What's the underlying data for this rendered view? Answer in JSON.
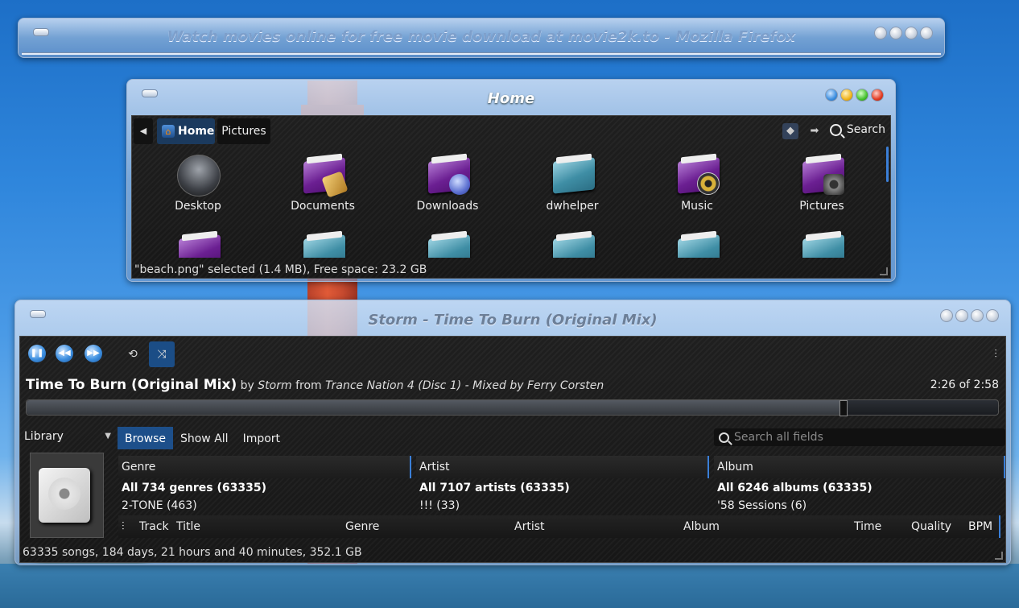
{
  "firefox": {
    "title": "Watch movies online for free movie download at movie2k.to - Mozilla Firefox"
  },
  "file_manager": {
    "title": "Home",
    "breadcrumbs": [
      {
        "label": "Home",
        "active": true
      },
      {
        "label": "Pictures",
        "active": false
      }
    ],
    "search_label": "Search",
    "items": [
      {
        "label": "Desktop",
        "icon": "desktop-icon",
        "color": "#444"
      },
      {
        "label": "Documents",
        "icon": "documents-folder-icon",
        "color": "#7a2aa3"
      },
      {
        "label": "Downloads",
        "icon": "downloads-folder-icon",
        "color": "#7a2aa3"
      },
      {
        "label": "dwhelper",
        "icon": "folder-icon",
        "color": "#3f8ea5"
      },
      {
        "label": "Music",
        "icon": "music-folder-icon",
        "color": "#7a2aa3"
      },
      {
        "label": "Pictures",
        "icon": "pictures-folder-icon",
        "color": "#7a2aa3"
      }
    ],
    "status": "\"beach.png\" selected (1.4 MB), Free space: 23.2 GB"
  },
  "music_player": {
    "title": "Storm - Time To Burn (Original Mix)",
    "now_playing": {
      "track": "Time To Burn (Original Mix)",
      "by_word": "by",
      "artist": "Storm",
      "from_word": "from",
      "album": "Trance Nation 4 (Disc 1) - Mixed by Ferry Corsten"
    },
    "time_position": "2:26 of 2:58",
    "progress": 0.84,
    "library_label": "Library",
    "tabs": [
      {
        "label": "Browse",
        "active": true
      },
      {
        "label": "Show All",
        "active": false
      },
      {
        "label": "Import",
        "active": false
      }
    ],
    "search_placeholder": "Search all fields",
    "browser_columns": [
      {
        "header": "Genre",
        "all": "All 734 genres (63335)",
        "first": "2-TONE (463)"
      },
      {
        "header": "Artist",
        "all": "All 7107 artists (63335)",
        "first": "!!! (33)"
      },
      {
        "header": "Album",
        "all": "All 6246 albums (63335)",
        "first": "'58 Sessions (6)"
      }
    ],
    "track_columns": [
      "Track",
      "Title",
      "Genre",
      "Artist",
      "Album",
      "Time",
      "Quality",
      "BPM"
    ],
    "status": "63335 songs, 184 days, 21 hours and 40 minutes, 352.1 GB"
  }
}
